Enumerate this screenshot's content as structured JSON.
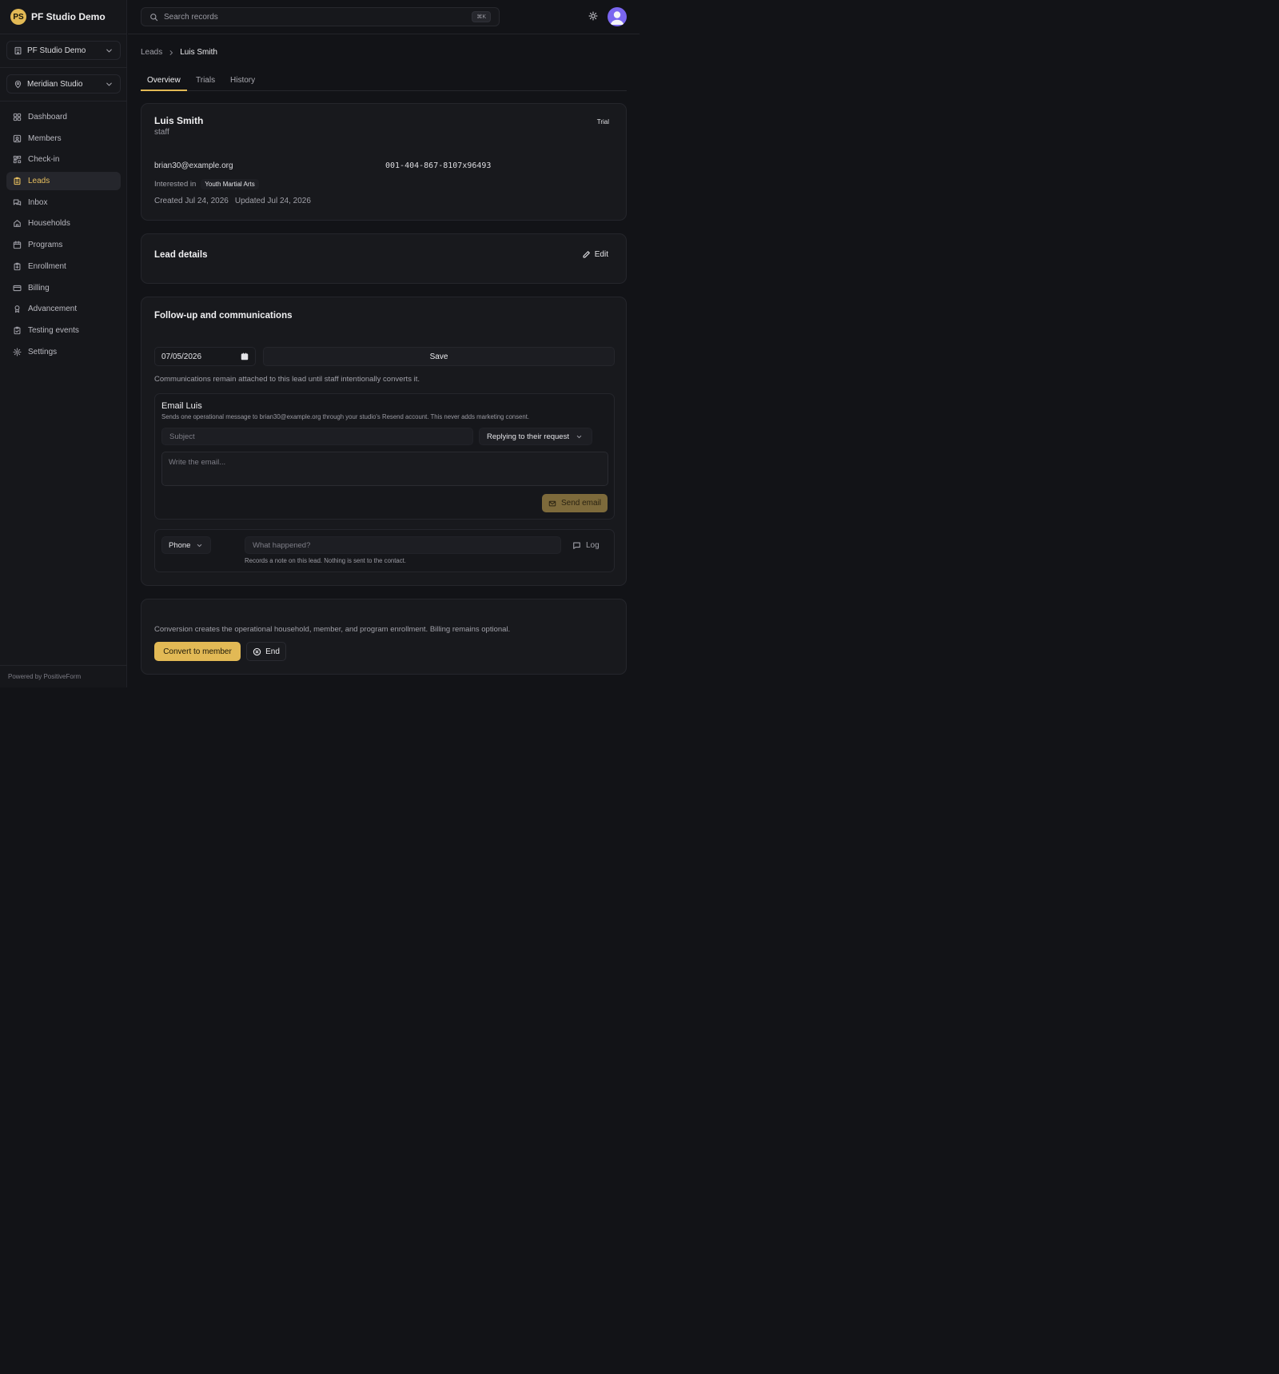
{
  "app": {
    "brand_initials": "PS",
    "brand_name": "PF Studio Demo",
    "org_select": "PF Studio Demo",
    "location_select": "Meridian Studio",
    "powered_by": "Powered by PositiveForm"
  },
  "sidebar": {
    "items": [
      {
        "label": "Dashboard",
        "icon": "grid-icon"
      },
      {
        "label": "Members",
        "icon": "user-square-icon"
      },
      {
        "label": "Check-in",
        "icon": "scan-icon"
      },
      {
        "label": "Leads",
        "icon": "clipboard-icon",
        "active": true
      },
      {
        "label": "Inbox",
        "icon": "messages-icon"
      },
      {
        "label": "Households",
        "icon": "home-icon"
      },
      {
        "label": "Programs",
        "icon": "calendar-icon"
      },
      {
        "label": "Enrollment",
        "icon": "clipboard-plus-icon"
      },
      {
        "label": "Billing",
        "icon": "credit-card-icon"
      },
      {
        "label": "Advancement",
        "icon": "award-icon"
      },
      {
        "label": "Testing events",
        "icon": "clipboard-check-icon"
      },
      {
        "label": "Settings",
        "icon": "gear-icon"
      }
    ]
  },
  "topbar": {
    "search_placeholder": "Search records",
    "shortcut": "⌘K"
  },
  "breadcrumb": {
    "parent": "Leads",
    "current": "Luis Smith"
  },
  "tabs": [
    {
      "label": "Overview",
      "active": true
    },
    {
      "label": "Trials"
    },
    {
      "label": "History"
    }
  ],
  "lead": {
    "name": "Luis Smith",
    "role": "staff",
    "status": "Trial",
    "email": "brian30@example.org",
    "phone": "001-404-867-8107x96493",
    "interested_label": "Interested in",
    "program": "Youth Martial Arts",
    "created": "Created Jul 24, 2026",
    "updated": "Updated Jul 24, 2026"
  },
  "details": {
    "title": "Lead details",
    "edit_label": "Edit"
  },
  "followup": {
    "title": "Follow-up and communications",
    "date_value": "07/05/2026",
    "save_label": "Save",
    "note": "Communications remain attached to this lead until staff intentionally converts it.",
    "email": {
      "title": "Email Luis",
      "description": "Sends one operational message to brian30@example.org through your studio's Resend account. This never adds marketing consent.",
      "subject_placeholder": "Subject",
      "reply_select": "Replying to their request",
      "body_placeholder": "Write the email...",
      "send_label": "Send email"
    },
    "log": {
      "channel": "Phone",
      "placeholder": "What happened?",
      "note": "Records a note on this lead. Nothing is sent to the contact.",
      "button": "Log"
    }
  },
  "conversion": {
    "note": "Conversion creates the operational household, member, and program enrollment. Billing remains optional.",
    "convert_label": "Convert to member",
    "end_label": "End"
  },
  "colors": {
    "accent": "#e2b955",
    "background": "#121317",
    "card": "#18191d"
  }
}
